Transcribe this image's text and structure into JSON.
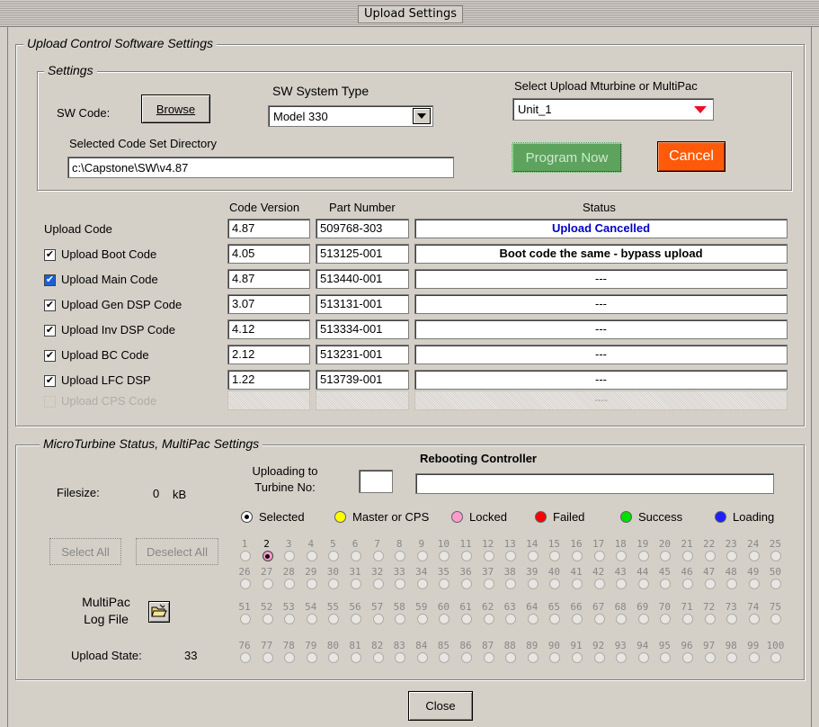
{
  "window": {
    "title": "Upload Settings"
  },
  "upload_group": {
    "legend": "Upload Control Software Settings"
  },
  "settings_group": {
    "legend": "Settings",
    "sw_code_label": "SW Code:",
    "browse_label": "Browse",
    "sw_system_type_label": "SW System Type",
    "sw_system_type_value": "Model 330",
    "select_upload_label": "Select Upload Mturbine or MultiPac",
    "select_upload_value": "Unit_1",
    "code_dir_label": "Selected Code Set Directory",
    "code_dir_value": "c:\\Capstone\\SW\\v4.87",
    "program_now_label": "Program Now",
    "cancel_label": "Cancel"
  },
  "table": {
    "headers": {
      "code_version": "Code Version",
      "part_number": "Part Number",
      "status": "Status"
    },
    "rows": [
      {
        "label": "Upload Code",
        "checkbox": "none",
        "version": "4.87",
        "part": "509768-303",
        "status": "Upload Cancelled",
        "status_color": "#0000c8",
        "bold": true
      },
      {
        "label": "Upload Boot Code",
        "checkbox": "checked",
        "version": "4.05",
        "part": "513125-001",
        "status": "Boot code the same - bypass upload",
        "status_color": "#000000",
        "bold": true
      },
      {
        "label": "Upload Main Code",
        "checkbox": "focused",
        "version": "4.87",
        "part": "513440-001",
        "status": "---",
        "status_color": "#000000",
        "bold": false
      },
      {
        "label": "Upload Gen DSP Code",
        "checkbox": "checked",
        "version": "3.07",
        "part": "513131-001",
        "status": "---",
        "status_color": "#000000",
        "bold": false
      },
      {
        "label": "Upload Inv DSP Code",
        "checkbox": "checked",
        "version": "4.12",
        "part": "513334-001",
        "status": "---",
        "status_color": "#000000",
        "bold": false
      },
      {
        "label": "Upload BC Code",
        "checkbox": "checked",
        "version": "2.12",
        "part": "513231-001",
        "status": "---",
        "status_color": "#000000",
        "bold": false
      },
      {
        "label": "Upload LFC DSP",
        "checkbox": "checked",
        "version": "1.22",
        "part": "513739-001",
        "status": "---",
        "status_color": "#000000",
        "bold": false
      },
      {
        "label": "Upload CPS Code",
        "checkbox": "disabled",
        "version": "",
        "part": "",
        "status": "----",
        "status_color": "#9a9a9a",
        "bold": false
      }
    ]
  },
  "status_group": {
    "legend": "MicroTurbine Status, MultiPac Settings",
    "filesize_label": "Filesize:",
    "filesize_value": "0",
    "filesize_unit": "kB",
    "uploading_to_label": "Uploading to Turbine No:",
    "rebooting_label": "Rebooting Controller",
    "select_all_label": "Select All",
    "deselect_all_label": "Deselect All",
    "log_file_label": "MultiPac Log File",
    "upload_state_label": "Upload State:",
    "upload_state_value": "33",
    "legend_items": [
      {
        "label": "Selected",
        "color": "#000000",
        "icon": "radio-selected-icon"
      },
      {
        "label": "Master or CPS",
        "color": "#ffff00",
        "icon": "yellow-dot-icon"
      },
      {
        "label": "Locked",
        "color": "#ff9ccd",
        "icon": "pink-dot-icon"
      },
      {
        "label": "Failed",
        "color": "#ff0000",
        "icon": "red-dot-icon"
      },
      {
        "label": "Success",
        "color": "#00e000",
        "icon": "green-dot-icon"
      },
      {
        "label": "Loading",
        "color": "#2020ff",
        "icon": "blue-dot-icon"
      }
    ],
    "turbines": [
      "1",
      "2",
      "3",
      "4",
      "5",
      "6",
      "7",
      "8",
      "9",
      "10",
      "11",
      "12",
      "13",
      "14",
      "15",
      "16",
      "17",
      "18",
      "19",
      "20",
      "21",
      "22",
      "23",
      "24",
      "25",
      "26",
      "27",
      "28",
      "29",
      "30",
      "31",
      "32",
      "33",
      "34",
      "35",
      "36",
      "37",
      "38",
      "39",
      "40",
      "41",
      "42",
      "43",
      "44",
      "45",
      "46",
      "47",
      "48",
      "49",
      "50",
      "51",
      "52",
      "53",
      "54",
      "55",
      "56",
      "57",
      "58",
      "59",
      "60",
      "61",
      "62",
      "63",
      "64",
      "65",
      "66",
      "67",
      "68",
      "69",
      "70",
      "71",
      "72",
      "73",
      "74",
      "75",
      "76",
      "77",
      "78",
      "79",
      "80",
      "81",
      "82",
      "83",
      "84",
      "85",
      "86",
      "87",
      "88",
      "89",
      "90",
      "91",
      "92",
      "93",
      "94",
      "95",
      "96",
      "97",
      "98",
      "99",
      "100"
    ],
    "selected_turbine": "2",
    "locked_turbine": "2"
  },
  "close_label": "Close"
}
